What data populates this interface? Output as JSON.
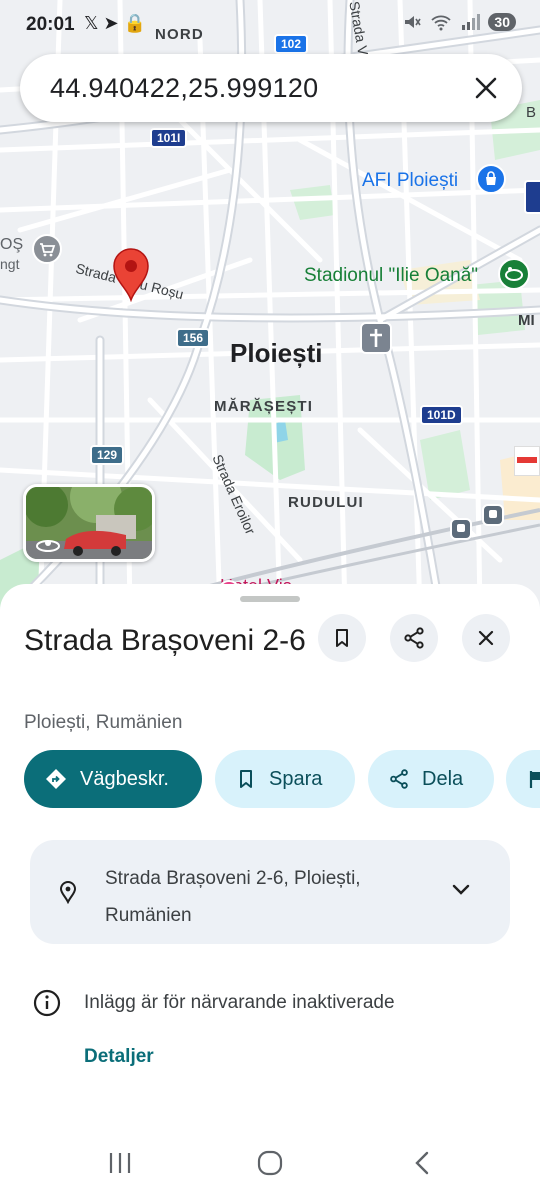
{
  "status_bar": {
    "time": "20:01",
    "left_icons": "𝕏 ➤ 🔒",
    "battery": "30"
  },
  "search": {
    "query": "44.940422,25.999120"
  },
  "map": {
    "city": "Ploiești",
    "districts": [
      "NORD",
      "MĂRĂȘEȘTI",
      "RUDULUI"
    ],
    "streets": [
      "Strada Calu Roșu",
      "Strada Eroilor",
      "Strada V"
    ],
    "pois": [
      "AFI Ploiești",
      "Stadionul \"Ilie Oană\"",
      "Hotel Vis",
      "OŞ",
      "ngt",
      "MI",
      "B"
    ],
    "road_shields": [
      "102",
      "101I",
      "156",
      "129",
      "101D"
    ]
  },
  "sheet": {
    "title": "Strada Brașoveni 2-6",
    "subtitle": "Ploiești, Rumänien",
    "actions": {
      "directions": "Vägbeskr.",
      "save": "Spara",
      "share": "Dela"
    },
    "address": "Strada Brașoveni 2-6, Ploiești, Rumänien",
    "notice": "Inlägg är för närvarande inaktiverade",
    "details_link": "Detaljer"
  },
  "colors": {
    "accent": "#0b6e79",
    "chip_bg": "#d8f2fb",
    "pin": "#ea4335",
    "map_bg": "#eef0f3",
    "park": "#c8ebd0"
  }
}
